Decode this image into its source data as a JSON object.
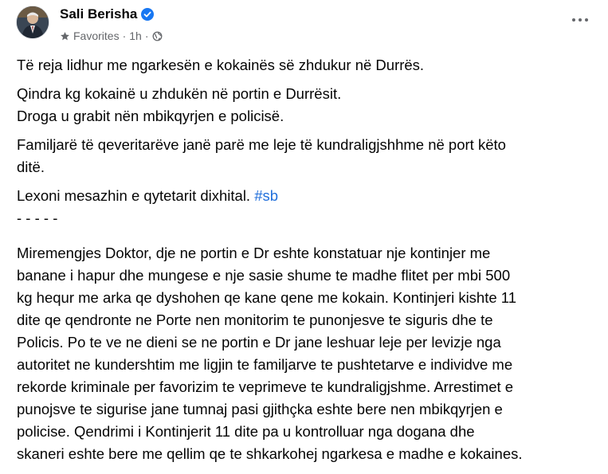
{
  "post": {
    "author": "Sali Berisha",
    "audience": "Favorites",
    "separator": "·",
    "time": "1h",
    "verified_icon": "verified-badge-icon",
    "accent_color": "#1877f2",
    "link_color": "#216fdb"
  },
  "body": {
    "p1": "Të reja lidhur me ngarkesën e kokainës së zhdukur në Durrës.",
    "p2_l1": "Qindra kg kokainë u zhdukën në portin e Durrësit.",
    "p2_l2": "Droga u grabit nën mbikqyrjen e policisë.",
    "p3_l1": "Familjarë të qeveritarëve janë parë me leje të kundraligjshhme në port këto",
    "p3_l2": "ditë.",
    "p4_text": "Lexoni mesazhin e qytetarit dixhital. ",
    "p4_hashtag": "#sb",
    "divider": "- - - - -",
    "m1": "Miremengjes Doktor, dje ne portin e Dr eshte konstatuar nje kontinjer me",
    "m2": "banane i hapur dhe mungese e nje sasie shume te madhe flitet per mbi 500",
    "m3": "kg hequr me arka qe dyshohen qe kane qene me kokain. Kontinjeri kishte 11",
    "m4": "dite qe qendronte ne Porte nen monitorim te punonjesve te siguris dhe te",
    "m5": "Policis. Po te ve ne dieni se ne portin e Dr jane leshuar leje per levizje nga",
    "m6": "autoritet ne kundershtim me ligjin te familjarve te pushtetarve e individve me",
    "m7": "rekorde kriminale per favorizim te veprimeve te kundraligjshme. Arrestimet e",
    "m8": "punojsve te sigurise jane tumnaj pasi gjithçka eshte bere nen mbikqyrjen e",
    "m9": "policise. Qendrimi i Kontinjerit 11 dite pa u kontrolluar nga dogana dhe",
    "m10": "skaneri eshte bere me qellim qe te shkarkohej ngarkesa e madhe e kokaines."
  }
}
